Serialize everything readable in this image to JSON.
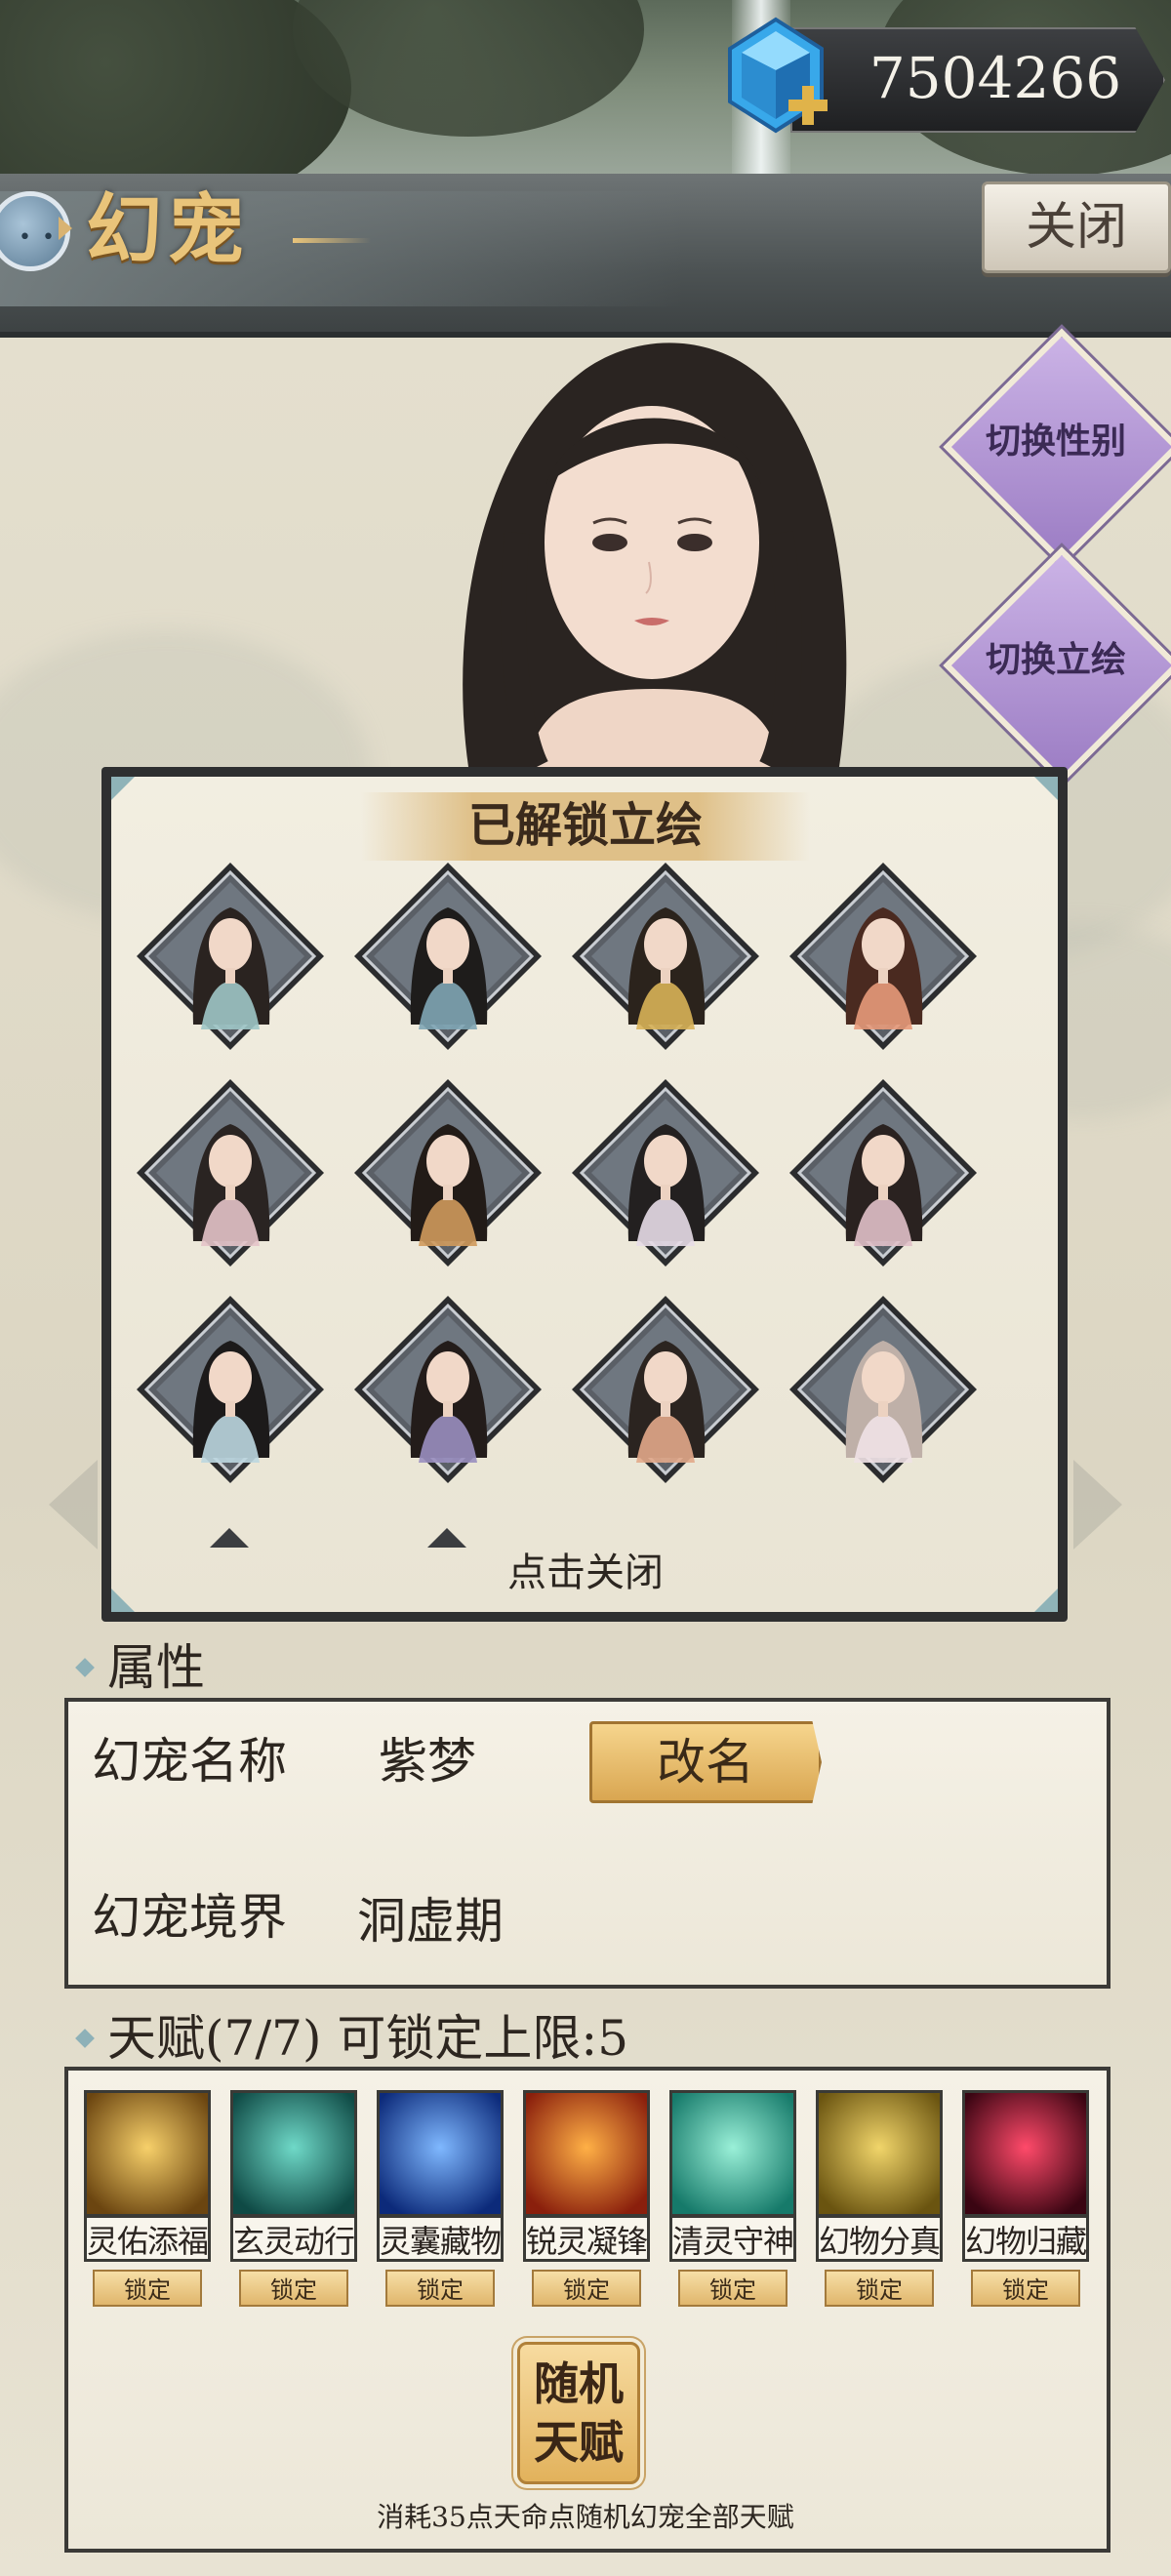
{
  "currency": {
    "value": "7504266",
    "icon": "blue-gem-plus-icon"
  },
  "header": {
    "title": "幻宠",
    "close_label": "关闭"
  },
  "side_buttons": {
    "switch_gender": "切换性别",
    "switch_portrait": "切换立绘"
  },
  "unlocked_panel": {
    "title": "已解锁立绘",
    "close_hint": "点击关闭",
    "portraits": [
      {
        "hair": "#2a2320",
        "accent": "#9ec6c6"
      },
      {
        "hair": "#1e1c1b",
        "accent": "#7fa6b5"
      },
      {
        "hair": "#2b231c",
        "accent": "#d8b258"
      },
      {
        "hair": "#4a2a20",
        "accent": "#e79a7a"
      },
      {
        "hair": "#2a2422",
        "accent": "#e3c3c8"
      },
      {
        "hair": "#221b17",
        "accent": "#cf9a5c"
      },
      {
        "hair": "#232020",
        "accent": "#e7dbe7"
      },
      {
        "hair": "#2a2220",
        "accent": "#e0c0c8"
      },
      {
        "hair": "#1c1a1a",
        "accent": "#bcd7e0"
      },
      {
        "hair": "#231c1a",
        "accent": "#9a8fc0"
      },
      {
        "hair": "#2b2420",
        "accent": "#e2a98a"
      },
      {
        "hair": "#bfb0a8",
        "accent": "#efe2e6"
      }
    ]
  },
  "attributes": {
    "section_title": "属性",
    "name_label": "幻宠名称",
    "name_value": "紫梦",
    "rename_label": "改名",
    "realm_label": "幻宠境界",
    "realm_value": "洞虚期"
  },
  "talents": {
    "section_title": "天赋(7/7) 可锁定上限:5",
    "lock_label": "锁定",
    "items": [
      {
        "name": "灵佑添福",
        "icon": "golden-coins-icon",
        "c1": "#f7d06a",
        "c2": "#6b4510"
      },
      {
        "name": "玄灵动行",
        "icon": "teal-wind-icon",
        "c1": "#6fd9c8",
        "c2": "#0f4a45"
      },
      {
        "name": "灵囊藏物",
        "icon": "blue-lotus-icon",
        "c1": "#7fb8ff",
        "c2": "#0c2a7a"
      },
      {
        "name": "锐灵凝锋",
        "icon": "flaming-blade-icon",
        "c1": "#ffb046",
        "c2": "#8a1f0c"
      },
      {
        "name": "清灵守神",
        "icon": "cyan-rays-icon",
        "c1": "#9af0d8",
        "c2": "#167a6a"
      },
      {
        "name": "幻物分真",
        "icon": "golden-hand-icon",
        "c1": "#f1d56a",
        "c2": "#6a5410"
      },
      {
        "name": "幻物归藏",
        "icon": "crimson-slash-icon",
        "c1": "#ff4a6a",
        "c2": "#3a0512"
      }
    ],
    "random_label_line1": "随机",
    "random_label_line2": "天赋",
    "random_desc": "消耗35点天命点随机幻宠全部天赋"
  }
}
